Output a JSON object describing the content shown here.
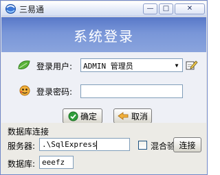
{
  "window": {
    "title": "三易通",
    "banner_title": "系统登录",
    "minimize_icon": "minimize-icon",
    "maximize_icon": "maximize-icon",
    "close_icon": "close-icon"
  },
  "login": {
    "user_label": "登录用户:",
    "user_value": "ADMIN 管理员",
    "password_label": "登录密码:",
    "password_value": "",
    "ok_label": "确定",
    "cancel_label": "取消"
  },
  "database": {
    "section_label": "数据库连接",
    "server_label": "服务器:",
    "server_value": ".\\SqlExpress",
    "mixed_auth_label": "混合验证",
    "mixed_auth_checked": false,
    "connect_label": "连接",
    "db_label": "数据库:",
    "db_value": "eeefz"
  },
  "colors": {
    "banner": "#6a88d2",
    "accent": "#2e4f9f"
  }
}
